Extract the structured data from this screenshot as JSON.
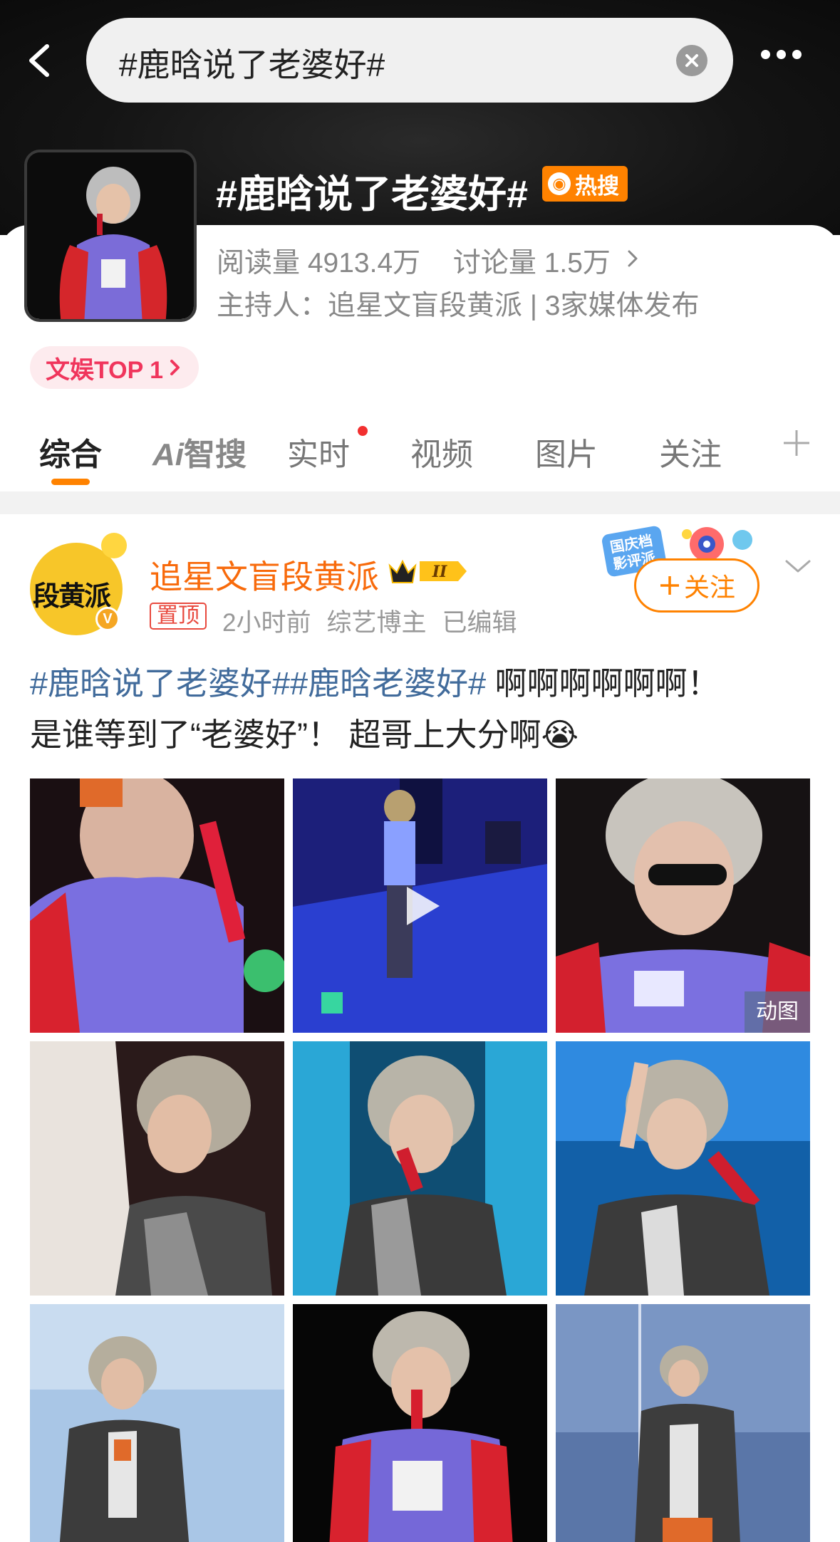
{
  "search": {
    "query": "#鹿晗说了老婆好#"
  },
  "topic": {
    "title": "#鹿晗说了老婆好#",
    "hot_badge": "热搜",
    "reads_label": "阅读量",
    "reads_value": "4913.4万",
    "discuss_label": "讨论量",
    "discuss_value": "1.5万",
    "host_line": "主持人：追星文盲段黄派 | 3家媒体发布",
    "rank_label": "文娱TOP 1"
  },
  "tabs": [
    {
      "label": "综合"
    },
    {
      "label": "智搜",
      "prefix": "Ai"
    },
    {
      "label": "实时"
    },
    {
      "label": "视频"
    },
    {
      "label": "图片"
    },
    {
      "label": "关注"
    }
  ],
  "post": {
    "author": "追星文盲段黄派",
    "avatar_text": "段黄派",
    "vip_level": "II",
    "pin_label": "置顶",
    "time": "2小时前",
    "role": "综艺博主",
    "edited": "已编辑",
    "follow_label": "关注",
    "follow_deco_text": "国庆档影评派",
    "hashtag1": "#鹿晗说了老婆好#",
    "hashtag2": "#鹿晗老婆好#",
    "text_line1_rest": " 啊啊啊啊啊啊！",
    "text_line2": "是谁等到了“老婆好”！ 超哥上大分啊",
    "emoji": "😭",
    "gif_label": "动图"
  },
  "colors": {
    "accent": "#ff8200",
    "hashtag": "#416b9b",
    "author": "#f86a0b",
    "rank": "#f0355c"
  },
  "icons": [
    "back-arrow-icon",
    "clear-icon",
    "more-icon",
    "chevron-right-icon",
    "plus-icon",
    "chevron-down-icon",
    "play-icon",
    "crown-icon"
  ]
}
